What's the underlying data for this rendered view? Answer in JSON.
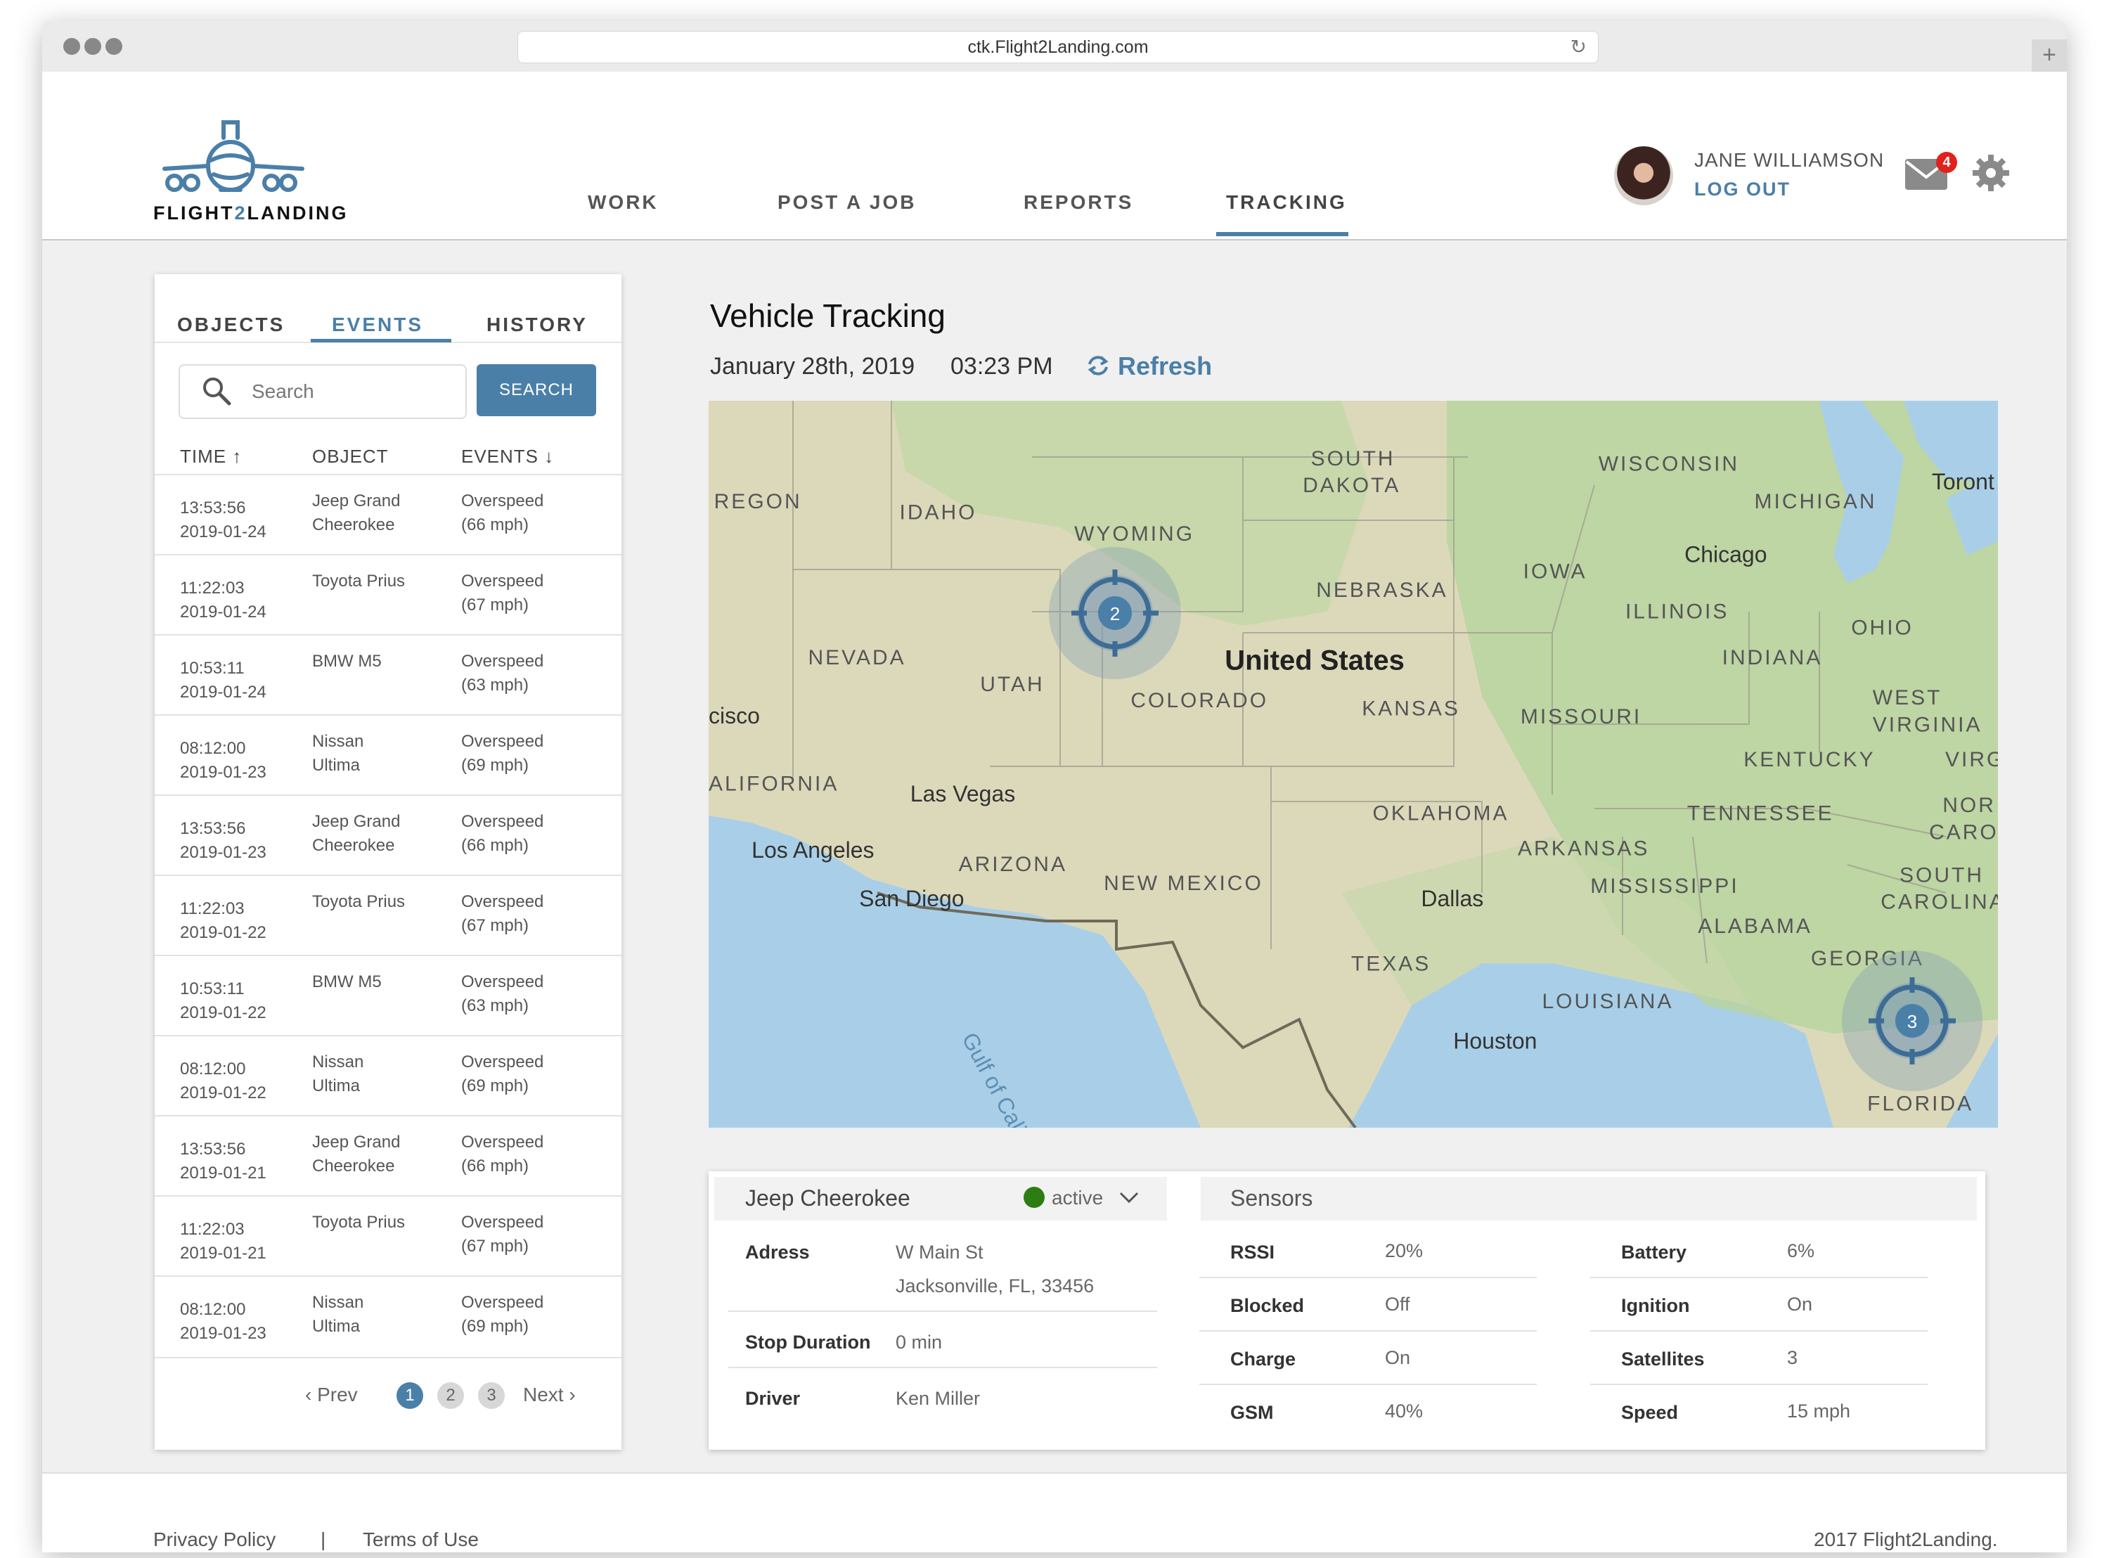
{
  "browser": {
    "url": "ctk.Flight2Landing.com"
  },
  "brand": {
    "name_part1": "FLIGHT",
    "name_part2": "2",
    "name_part3": "LANDING"
  },
  "nav": {
    "items": [
      "WORK",
      "POST A JOB",
      "REPORTS",
      "TRACKING"
    ],
    "active": "TRACKING"
  },
  "user": {
    "name": "JANE WILLIAMSON",
    "logout": "LOG OUT",
    "notifications": "4"
  },
  "left_panel": {
    "tabs": [
      "OBJECTS",
      "EVENTS",
      "HISTORY"
    ],
    "active_tab": "EVENTS",
    "search_placeholder": "Search",
    "search_button": "SEARCH",
    "columns": [
      "TIME ↑",
      "OBJECT",
      "EVENTS ↓"
    ],
    "rows": [
      {
        "time": "13:53:56",
        "date": "2019-01-24",
        "object1": "Jeep Grand",
        "object2": "Cheerokee",
        "event1": "Overspeed",
        "event2": "(66 mph)"
      },
      {
        "time": "11:22:03",
        "date": "2019-01-24",
        "object1": "Toyota Prius",
        "object2": "",
        "event1": "Overspeed",
        "event2": "(67 mph)"
      },
      {
        "time": "10:53:11",
        "date": "2019-01-24",
        "object1": "BMW M5",
        "object2": "",
        "event1": "Overspeed",
        "event2": "(63 mph)"
      },
      {
        "time": "08:12:00",
        "date": "2019-01-23",
        "object1": "Nissan",
        "object2": "Ultima",
        "event1": "Overspeed",
        "event2": "(69 mph)"
      },
      {
        "time": "13:53:56",
        "date": "2019-01-23",
        "object1": "Jeep Grand",
        "object2": "Cheerokee",
        "event1": "Overspeed",
        "event2": "(66 mph)"
      },
      {
        "time": "11:22:03",
        "date": "2019-01-22",
        "object1": "Toyota Prius",
        "object2": "",
        "event1": "Overspeed",
        "event2": "(67 mph)"
      },
      {
        "time": "10:53:11",
        "date": "2019-01-22",
        "object1": "BMW M5",
        "object2": "",
        "event1": "Overspeed",
        "event2": "(63 mph)"
      },
      {
        "time": "08:12:00",
        "date": "2019-01-22",
        "object1": "Nissan",
        "object2": "Ultima",
        "event1": "Overspeed",
        "event2": "(69 mph)"
      },
      {
        "time": "13:53:56",
        "date": "2019-01-21",
        "object1": "Jeep Grand",
        "object2": "Cheerokee",
        "event1": "Overspeed",
        "event2": "(66 mph)"
      },
      {
        "time": "11:22:03",
        "date": "2019-01-21",
        "object1": "Toyota Prius",
        "object2": "",
        "event1": "Overspeed",
        "event2": "(67 mph)"
      },
      {
        "time": "08:12:00",
        "date": "2019-01-23",
        "object1": "Nissan",
        "object2": "Ultima",
        "event1": "Overspeed",
        "event2": "(69 mph)"
      }
    ],
    "pagination": {
      "prev": "Prev",
      "pages": [
        "1",
        "2",
        "3"
      ],
      "current": "1",
      "next": "Next"
    }
  },
  "main": {
    "title": "Vehicle Tracking",
    "date": "January 28th, 2019",
    "time": "03:23 PM",
    "refresh": "Refresh"
  },
  "map": {
    "labels": [
      "REGON",
      "IDAHO",
      "WYOMING",
      "SOUTH",
      "DAKOTA",
      "WISCONSIN",
      "MICHIGAN",
      "Toront",
      "NEBRASKA",
      "IOWA",
      "Chicago",
      "ILLINOIS",
      "OHIO",
      "NEVADA",
      "UTAH",
      "United States",
      "INDIANA",
      "COLORADO",
      "KANSAS",
      "MISSOURI",
      "WEST",
      "VIRGINIA",
      "cisco",
      "KENTUCKY",
      "VIRGI",
      "ALIFORNIA",
      "Las Vegas",
      "OKLAHOMA",
      "TENNESSEE",
      "NOR",
      "CAROL",
      "Los Angeles",
      "ARKANSAS",
      "ARIZONA",
      "NEW MEXICO",
      "San Diego",
      "Dallas",
      "MISSISSIPPI",
      "SOUTH",
      "CAROLINA",
      "ALABAMA",
      "GEORGIA",
      "TEXAS",
      "LOUISIANA",
      "Houston",
      "FLORIDA",
      "Gulf of Cali"
    ],
    "clusters": [
      "2",
      "3"
    ]
  },
  "details": {
    "vehicle": "Jeep Cheerokee",
    "status": "active",
    "status_color": "#2e7d12",
    "address_label": "Adress",
    "address_line1": "W Main St",
    "address_line2": "Jacksonville, FL, 33456",
    "stop_label": "Stop Duration",
    "stop_value": "0 min",
    "driver_label": "Driver",
    "driver_value": "Ken Miller",
    "sensors_title": "Sensors",
    "sensors_left": [
      {
        "label": "RSSI",
        "value": "20%"
      },
      {
        "label": "Blocked",
        "value": "Off"
      },
      {
        "label": "Charge",
        "value": "On"
      },
      {
        "label": "GSM",
        "value": "40%"
      }
    ],
    "sensors_right": [
      {
        "label": "Battery",
        "value": "6%"
      },
      {
        "label": "Ignition",
        "value": "On"
      },
      {
        "label": "Satellites",
        "value": "3"
      },
      {
        "label": "Speed",
        "value": "15 mph"
      }
    ]
  },
  "footer": {
    "privacy": "Privacy Policy",
    "separator": "|",
    "terms": "Terms of Use",
    "copyright": "2017 Flight2Landing."
  },
  "colors": {
    "accent": "#4a7fa8",
    "badge": "#e0221c"
  }
}
